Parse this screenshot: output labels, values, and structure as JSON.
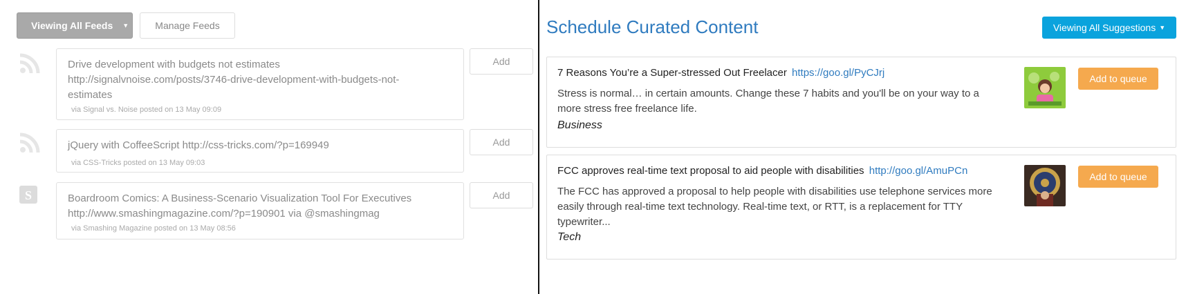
{
  "left": {
    "view_feeds_label": "Viewing All Feeds",
    "manage_feeds_label": "Manage Feeds",
    "feeds": [
      {
        "icon": "rss-icon",
        "title": "Drive development with budgets not estimates http://signalvnoise.com/posts/3746-drive-development-with-budgets-not-estimates",
        "meta": "via Signal vs. Noise posted on 13 May 09:09",
        "add_label": "Add"
      },
      {
        "icon": "rss-icon",
        "title": "jQuery with CoffeeScript http://css-tricks.com/?p=169949",
        "meta": "via CSS-Tricks posted on 13 May 09:03",
        "add_label": "Add"
      },
      {
        "icon": "smashing-magazine-logo-icon",
        "title": "Boardroom Comics: A Business-Scenario Visualization Tool For Executives http://www.smashingmagazine.com/?p=190901 via @smashingmag",
        "meta": "via Smashing Magazine posted on 13 May 08:56",
        "add_label": "Add"
      }
    ]
  },
  "right": {
    "title": "Schedule Curated Content",
    "suggestions_label": "Viewing All Suggestions",
    "items": [
      {
        "headline": "7 Reasons You’re a Super-stressed Out Freelacer",
        "link": "https://goo.gl/PyCJrj",
        "description": "Stress is normal… in certain amounts. Change these 7 habits and you'll be on your way to a more stress free freelance life.",
        "category": "Business",
        "thumbnail": "stressed-freelancer-thumbnail",
        "queue_label": "Add to queue"
      },
      {
        "headline": "FCC approves real-time text proposal to aid people with disabilities",
        "link": "http://goo.gl/AmuPCn",
        "description": "The FCC has approved a proposal to help people with disabilities use telephone services more easily through real-time text technology. Real-time text, or RTT, is a replacement for TTY typewriter...",
        "category": "Tech",
        "thumbnail": "fcc-seal-thumbnail",
        "queue_label": "Add to queue"
      }
    ]
  },
  "colors": {
    "title_blue": "#2f7bbf",
    "suggestions_button": "#0aa3dd",
    "queue_button": "#f5a94e",
    "view_feeds_button": "#a9a9a9"
  }
}
